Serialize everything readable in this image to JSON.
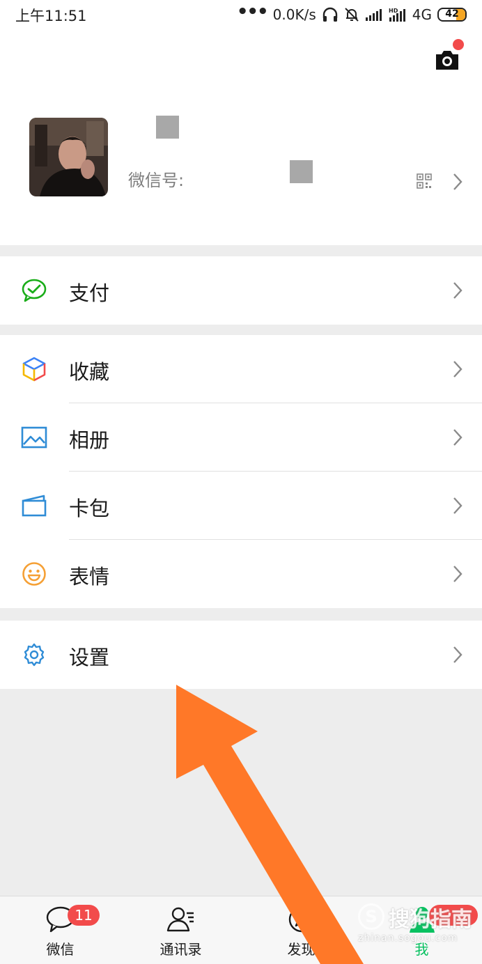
{
  "status_bar": {
    "time": "上午11:51",
    "dots": "•••",
    "net_speed": "0.0K/s",
    "network": "4G",
    "battery": "42"
  },
  "profile": {
    "wechat_id_label": "微信号:"
  },
  "menu": {
    "pay": "支付",
    "favorites": "收藏",
    "album": "相册",
    "cards": "卡包",
    "stickers": "表情",
    "settings": "设置"
  },
  "tabbar": {
    "chats": "微信",
    "contacts": "通讯录",
    "discover": "发现",
    "me": "我",
    "chats_badge": "11"
  },
  "watermark": {
    "mark": "S",
    "text": "搜狗指南",
    "url": "zhinan.sogou.com"
  },
  "colors": {
    "active_green": "#07c160",
    "badge_red": "#f24b4b",
    "arrow_orange": "#ff7828"
  }
}
